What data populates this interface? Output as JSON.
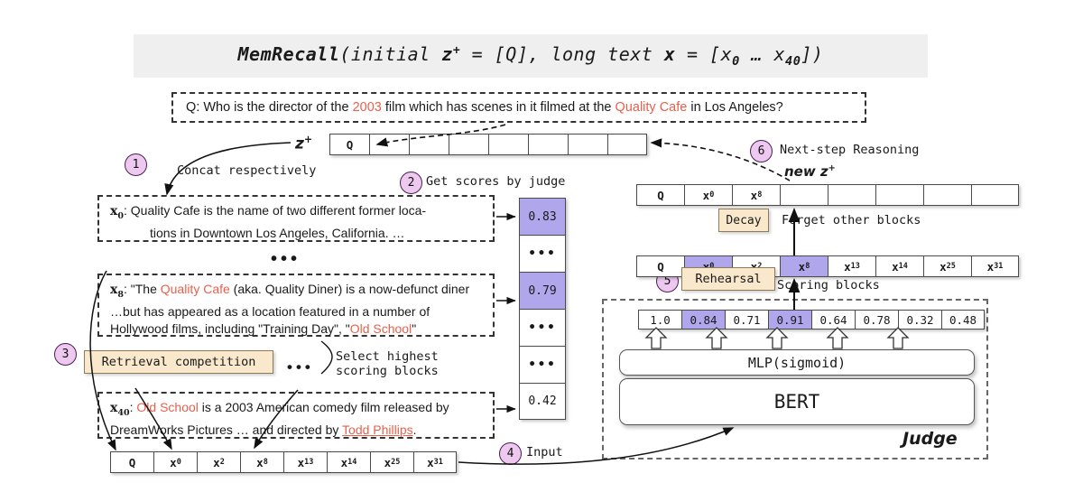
{
  "title": {
    "name": "MemRecall",
    "arg1_prefix": "(initial ",
    "arg1_var": "z",
    "arg1_sup": "+",
    "arg1_rest": " = [Q], ",
    "arg2_prefix": "long text ",
    "arg2_var": "x",
    "arg2_rest": " = [x",
    "arg2_sub1": "0",
    "arg2_mid": " … x",
    "arg2_sub2": "40",
    "arg2_suffix": "])"
  },
  "question": {
    "prefix": "Q: Who is the director of the ",
    "hl1": "2003",
    "mid": " film which has scenes in it filmed at the ",
    "hl2": "Quality Cafe",
    "suffix": " in Los Angeles?"
  },
  "z_plus": {
    "label_var": "z",
    "label_sup": "+",
    "cells": [
      "Q",
      "",
      "",
      "",
      "",
      "",
      "",
      ""
    ]
  },
  "steps": {
    "s1": {
      "num": "1",
      "label": "Concat respectively"
    },
    "s2": {
      "num": "2",
      "label": "Get scores by judge"
    },
    "s3": {
      "num": "3"
    },
    "s4": {
      "num": "4",
      "label": "Input"
    },
    "s5": {
      "num": "5",
      "label": "Select highest\nScoring blocks"
    },
    "s6": {
      "num": "6",
      "label": "Next-step Reasoning"
    }
  },
  "passages": [
    {
      "id": "x0",
      "tag": "x",
      "tag_sub": "0",
      "line1_a": ": Quality Cafe is the name of two different former loca-",
      "line2": "tions in Downtown Los Angeles, California. …"
    },
    {
      "id": "x8",
      "tag": "x",
      "tag_sub": "8",
      "a": ": \"The ",
      "hl1": "Quality Cafe",
      "b": " (aka. Quality Diner) is a now-defunct diner …but has appeared as a location featured in a number of Hollywood films, including \"Training Day\", \"",
      "hl2": "Old School",
      "c": "\""
    },
    {
      "id": "x40",
      "tag": "x",
      "tag_sub": "40",
      "a": ": ",
      "hl1": "Old School",
      "b": " is a 2003 American comedy film released by DreamWorks Pictures … and directed by ",
      "ul1": "Todd Phillips",
      "c": "."
    }
  ],
  "ellipsis": {
    "between_passages": "•••",
    "retrieval": "•••"
  },
  "retrieval": {
    "box_label": "Retrieval competition",
    "caption": "Select highest\nscoring blocks"
  },
  "scores_column": {
    "cells": [
      {
        "value": "0.83",
        "selected": true
      },
      {
        "value": "•••",
        "selected": false
      },
      {
        "value": "0.79",
        "selected": true
      },
      {
        "value": "•••",
        "selected": false
      },
      {
        "value": "•••",
        "selected": false
      },
      {
        "value": "0.42",
        "selected": false
      }
    ]
  },
  "new_z": {
    "label": "new z",
    "label_sup": "+",
    "cells": [
      "Q",
      "x0",
      "x8",
      "",
      "",
      "",
      "",
      ""
    ]
  },
  "decay": {
    "label": "Decay",
    "caption": "Forget other blocks"
  },
  "rehearsal": {
    "label": "Rehearsal",
    "caption": "Select highest\nScoring blocks"
  },
  "blocks_row": {
    "cells": [
      {
        "value": "Q",
        "selected": false
      },
      {
        "value": "x0",
        "selected": true
      },
      {
        "value": "x2",
        "selected": false
      },
      {
        "value": "x8",
        "selected": true
      },
      {
        "value": "x13",
        "selected": false
      },
      {
        "value": "x14",
        "selected": false
      },
      {
        "value": "x25",
        "selected": false
      },
      {
        "value": "x31",
        "selected": false
      }
    ]
  },
  "judge": {
    "title": "Judge",
    "mlp_label": "MLP(sigmoid)",
    "bert_label": "BERT",
    "scores": [
      {
        "value": "1.0",
        "selected": false
      },
      {
        "value": "0.84",
        "selected": true
      },
      {
        "value": "0.71",
        "selected": false
      },
      {
        "value": "0.91",
        "selected": true
      },
      {
        "value": "0.64",
        "selected": false
      },
      {
        "value": "0.78",
        "selected": false
      },
      {
        "value": "0.32",
        "selected": false
      },
      {
        "value": "0.48",
        "selected": false
      }
    ]
  },
  "input_row": {
    "cells": [
      "Q",
      "x0",
      "x2",
      "x8",
      "x13",
      "x14",
      "x25",
      "x31"
    ]
  },
  "colors": {
    "accent_red": "#e8604c",
    "selected_purple": "#b0a6ec",
    "tan_box": "#fae8cd",
    "step_bullet": "#edc9ef",
    "banner_gray": "#efefef"
  }
}
